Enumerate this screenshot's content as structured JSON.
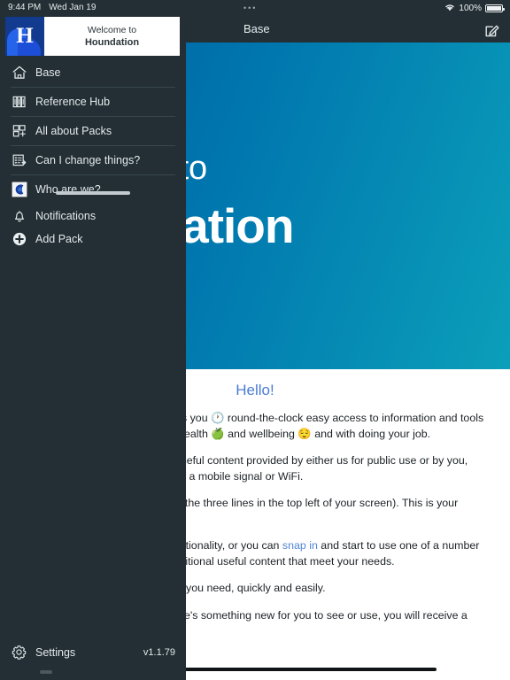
{
  "status_bar": {
    "time": "9:44 PM",
    "date": "Wed Jan 19",
    "dots": "•••",
    "wifi_icon": "wifi-icon",
    "battery_percent": "100%"
  },
  "nav_bar": {
    "title": "Base",
    "compose_icon": "compose-icon"
  },
  "hero": {
    "line1": "Welcome to",
    "line2": "Houndation",
    "gradient_start": "#005c9e",
    "gradient_end": "#0b9fba"
  },
  "article": {
    "heading": "Hello!",
    "heading_color": "#4a7cd4",
    "paragraphs": [
      {
        "id": "p1",
        "text": "Welcome to your new app! It gives you 🕐 round-the-clock easy access to information and tools to help with mental and physical health 🍏 and wellbeing 😌 and with doing your job."
      },
      {
        "id": "p2",
        "text": "This app lets you access lots of useful content provided by either us for public use or by you, even when you are out of range of a mobile signal or WiFi."
      },
      {
        "id": "p3",
        "text": "You are on the Base (just click on the three lines in the top left of your screen). This is your starting point."
      },
      {
        "id": "p4a",
        "text": "You can use the features and functionality, or you can ",
        "link_text": "snap in",
        "link_color": "#5086d8",
        "text_after": " and start to use one of a number of packs which give access to additional useful content that meet your needs."
      },
      {
        "id": "p5",
        "text": "Our aim is to help you get to what you need, quickly and easily."
      },
      {
        "id": "p6",
        "text": "When something changes, or there's something new for you to see or use, you will receive a notification to show where to look."
      }
    ]
  },
  "drawer": {
    "logo": {
      "letter": "H",
      "welcome_line": "Welcome to",
      "brand_line": "Houndation",
      "tile_color": "#123a8f"
    },
    "menu_primary": [
      {
        "label": "Base",
        "icon": "home-icon"
      },
      {
        "label": "Reference Hub",
        "icon": "books-icon"
      },
      {
        "label": "All about Packs",
        "icon": "grid-plus-icon"
      },
      {
        "label": "Can I change things?",
        "icon": "form-arrow-icon"
      },
      {
        "label": "Who are we?",
        "icon": "company-logo-icon"
      }
    ],
    "menu_secondary": [
      {
        "label": "Notifications",
        "icon": "bell-icon"
      },
      {
        "label": "Add Pack",
        "icon": "plus-circle-icon"
      }
    ],
    "footer": {
      "settings_label": "Settings",
      "settings_icon": "gear-icon",
      "version": "v1.1.79"
    }
  }
}
